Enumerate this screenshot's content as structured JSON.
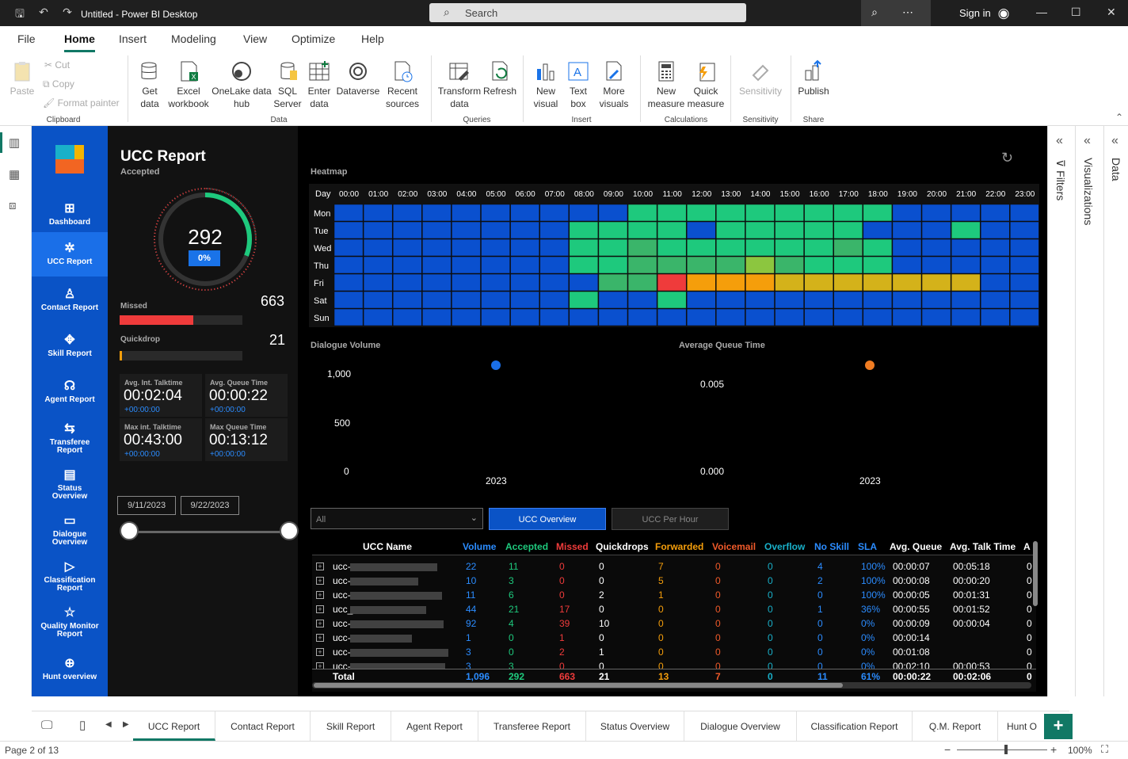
{
  "window": {
    "title": "Untitled - Power BI Desktop",
    "search": "Search",
    "signin": "Sign in"
  },
  "menu": [
    "File",
    "Home",
    "Insert",
    "Modeling",
    "View",
    "Optimize",
    "Help"
  ],
  "ribbon": {
    "clipboard": {
      "paste": "Paste",
      "cut": "Cut",
      "copy": "Copy",
      "format_painter": "Format painter",
      "group": "Clipboard"
    },
    "data": {
      "get_data": "Get data",
      "excel": "Excel workbook",
      "onelake": "OneLake data hub",
      "sql": "SQL Server",
      "enter": "Enter data",
      "dataverse": "Dataverse",
      "recent": "Recent sources",
      "group": "Data"
    },
    "queries": {
      "transform": "Transform data",
      "refresh": "Refresh",
      "group": "Queries"
    },
    "insert": {
      "new_visual": "New visual",
      "text_box": "Text box",
      "more_visuals": "More visuals",
      "group": "Insert"
    },
    "calculations": {
      "new_measure": "New measure",
      "quick_measure": "Quick measure",
      "group": "Calculations"
    },
    "sensitivity": {
      "label": "Sensitivity",
      "group": "Sensitivity"
    },
    "share": {
      "publish": "Publish",
      "group": "Share"
    }
  },
  "nav": [
    "Dashboard",
    "UCC Report",
    "Contact Report",
    "Skill Report",
    "Agent Report",
    "Transferee Report",
    "Status Overview",
    "Dialogue Overview",
    "Classification Report",
    "Quality Monitor Report",
    "Hunt overview"
  ],
  "panel": {
    "title": "UCC Report",
    "subtitle": "Accepted",
    "gauge_value": "292",
    "gauge_pct": "0%",
    "gauge_fraction": 0.31,
    "missed_label": "Missed",
    "missed_value": "663",
    "missed_fraction": 0.6,
    "quickdrop_label": "Quickdrop",
    "quickdrop_value": "21",
    "quickdrop_fraction": 0.02,
    "cards": [
      {
        "label": "Avg. Int. Talktime",
        "value": "00:02:04",
        "delta": "+00:00:00"
      },
      {
        "label": "Avg. Queue Time",
        "value": "00:00:22",
        "delta": "+00:00:00"
      },
      {
        "label": "Max int. Talktime",
        "value": "00:43:00",
        "delta": "+00:00:00"
      },
      {
        "label": "Max Queue Time",
        "value": "00:13:12",
        "delta": "+00:00:00"
      }
    ],
    "date_from": "9/11/2023",
    "date_to": "9/22/2023"
  },
  "heatmap": {
    "title": "Heatmap",
    "corner": "Day",
    "hours": [
      "00:00",
      "01:00",
      "02:00",
      "03:00",
      "04:00",
      "05:00",
      "06:00",
      "07:00",
      "08:00",
      "09:00",
      "10:00",
      "11:00",
      "12:00",
      "13:00",
      "14:00",
      "15:00",
      "16:00",
      "17:00",
      "18:00",
      "19:00",
      "20:00",
      "21:00",
      "22:00",
      "23:00"
    ],
    "days": [
      "Mon",
      "Tue",
      "Wed",
      "Thu",
      "Fri",
      "Sat",
      "Sun"
    ],
    "palette": {
      "b": "#0a50cf",
      "g": "#1ec97d",
      "m": "#3ab56a",
      "y": "#8cc63f",
      "o": "#f59e0b",
      "gd": "#d4b21a",
      "r": "#ef3b3b"
    },
    "rows": [
      "bbbbbbbbbbgggggggggbbbbb",
      "bbbbbbbbggggbgggggbbbgbb",
      "bbbbbbbbggmggggggmgbbbbb",
      "bbbbbbbbggmmmmymgggbbbbb",
      "bbbbbbbbbmmrooogdgdgdgdgdgdgdb",
      "bbbbbbbbgbbgbbbbbbbbbbbb",
      "bbbbbbbbbbbbbbbbbbbbbbbb"
    ]
  },
  "chart_data": [
    {
      "type": "scatter",
      "title": "Dialogue Volume",
      "x": [
        "2023"
      ],
      "values": [
        1040
      ],
      "yticks": [
        "0",
        "500",
        "1,000"
      ],
      "ylim": [
        0,
        1040
      ],
      "color": "#1a6fe8"
    },
    {
      "type": "scatter",
      "title": "Average Queue Time",
      "x": [
        "2023"
      ],
      "values": [
        0.0059
      ],
      "yticks": [
        "0.000",
        "0.005"
      ],
      "ylim": [
        0,
        0.0059
      ],
      "color": "#f07c22"
    }
  ],
  "table_controls": {
    "slicer": "All",
    "tab1": "UCC Overview",
    "tab2": "UCC Per Hour"
  },
  "table": {
    "headers": [
      "UCC Name",
      "Volume",
      "Accepted",
      "Missed",
      "Quickdrops",
      "Forwarded",
      "Voicemail",
      "Overflow",
      "No Skill",
      "SLA",
      "Avg. Queue",
      "Avg. Talk Time",
      "A"
    ],
    "header_colors": [
      "#fff",
      "#2b8cff",
      "#1ec97d",
      "#ef3b3b",
      "#fff",
      "#f59e0b",
      "#f05a2a",
      "#19b0c9",
      "#2b8cff",
      "#2b8cff",
      "#fff",
      "#fff",
      "#fff"
    ],
    "rows": [
      {
        "name": "ucc-",
        "c": [
          "22",
          "11",
          "0",
          "0",
          "7",
          "0",
          "0",
          "4",
          "100%",
          "00:00:07",
          "00:05:18",
          "0"
        ]
      },
      {
        "name": "ucc-",
        "c": [
          "10",
          "3",
          "0",
          "0",
          "5",
          "0",
          "0",
          "2",
          "100%",
          "00:00:08",
          "00:00:20",
          "0"
        ]
      },
      {
        "name": "ucc-",
        "c": [
          "11",
          "6",
          "0",
          "2",
          "1",
          "0",
          "0",
          "0",
          "100%",
          "00:00:05",
          "00:01:31",
          "0"
        ]
      },
      {
        "name": "ucc_",
        "c": [
          "44",
          "21",
          "17",
          "0",
          "0",
          "0",
          "0",
          "1",
          "36%",
          "00:00:55",
          "00:01:52",
          "0"
        ]
      },
      {
        "name": "ucc-",
        "c": [
          "92",
          "4",
          "39",
          "10",
          "0",
          "0",
          "0",
          "0",
          "0%",
          "00:00:09",
          "00:00:04",
          "0"
        ]
      },
      {
        "name": "ucc-",
        "c": [
          "1",
          "0",
          "1",
          "0",
          "0",
          "0",
          "0",
          "0",
          "0%",
          "00:00:14",
          "",
          "0"
        ]
      },
      {
        "name": "ucc-",
        "c": [
          "3",
          "0",
          "2",
          "1",
          "0",
          "0",
          "0",
          "0",
          "0%",
          "00:01:08",
          "",
          "0"
        ]
      },
      {
        "name": "ucc-",
        "c": [
          "3",
          "3",
          "0",
          "0",
          "0",
          "0",
          "0",
          "0",
          "0%",
          "00:02:10",
          "00:00:53",
          "0"
        ]
      }
    ],
    "total": {
      "name": "Total",
      "c": [
        "1,096",
        "292",
        "663",
        "21",
        "13",
        "7",
        "0",
        "11",
        "61%",
        "00:00:22",
        "00:02:06",
        "0"
      ]
    }
  },
  "visuals_pane": {
    "filters": "Filters",
    "visualizations": "Visualizations",
    "data": "Data"
  },
  "pages": [
    "UCC Report",
    "Contact Report",
    "Skill Report",
    "Agent Report",
    "Transferee Report",
    "Status Overview",
    "Dialogue Overview",
    "Classification Report",
    "Q.M. Report",
    "Hunt O"
  ],
  "status": {
    "page": "Page 2 of 13",
    "zoom": "100%"
  }
}
